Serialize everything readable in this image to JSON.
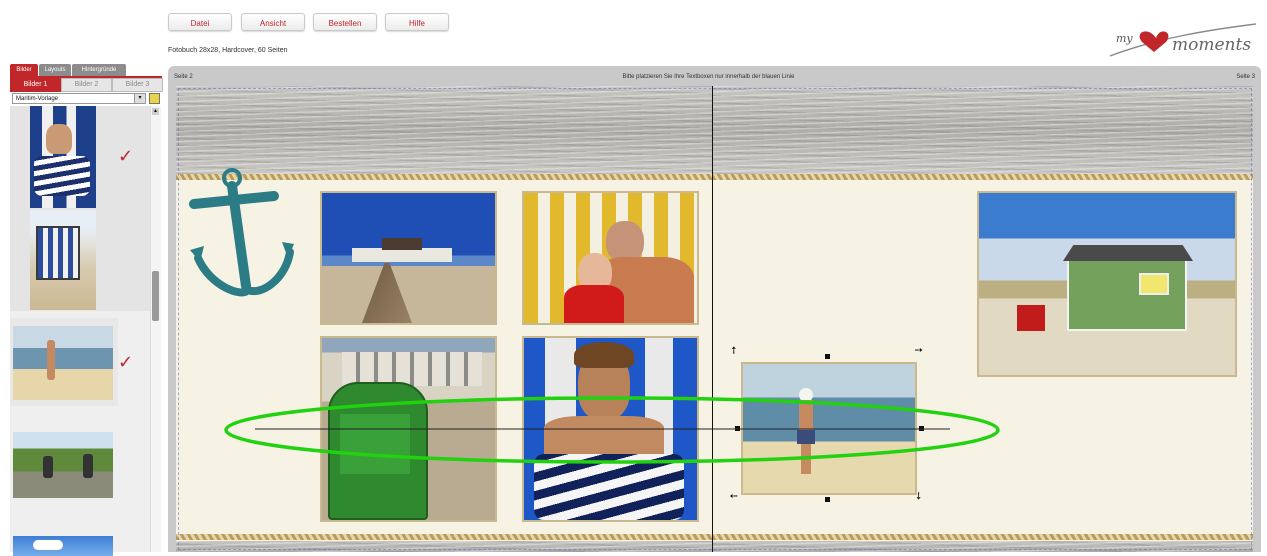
{
  "menu": {
    "datei": "Datei",
    "ansicht": "Ansicht",
    "bestellen": "Bestellen",
    "hilfe": "Hilfe"
  },
  "subtitle": "Fotobuch 28x28, Hardcover, 60 Seiten",
  "logo": {
    "text": "moments",
    "prefix": "my"
  },
  "sidebar": {
    "tabs": [
      "Bilder",
      "Layouts",
      "Hintergründe"
    ],
    "subtabs": [
      "Bilder 1",
      "Bilder 2",
      "Bilder 3"
    ],
    "dropdown_value": "Maritim-Vorlage",
    "checkmark": "✓"
  },
  "canvas": {
    "left_page_label": "Seite 2",
    "hint": "Bitte platzieren Sie Ihre Textboxen nur innerhalb der blauen Linie",
    "right_page_label": "Seite 3"
  },
  "icons": {
    "dropdown": "chevron-down-icon",
    "folder": "folder-icon",
    "anchor": "anchor-icon"
  },
  "colors": {
    "accent": "#c0262a",
    "highlight_ellipse": "#22d10f",
    "page_background": "#f6f2e4"
  }
}
